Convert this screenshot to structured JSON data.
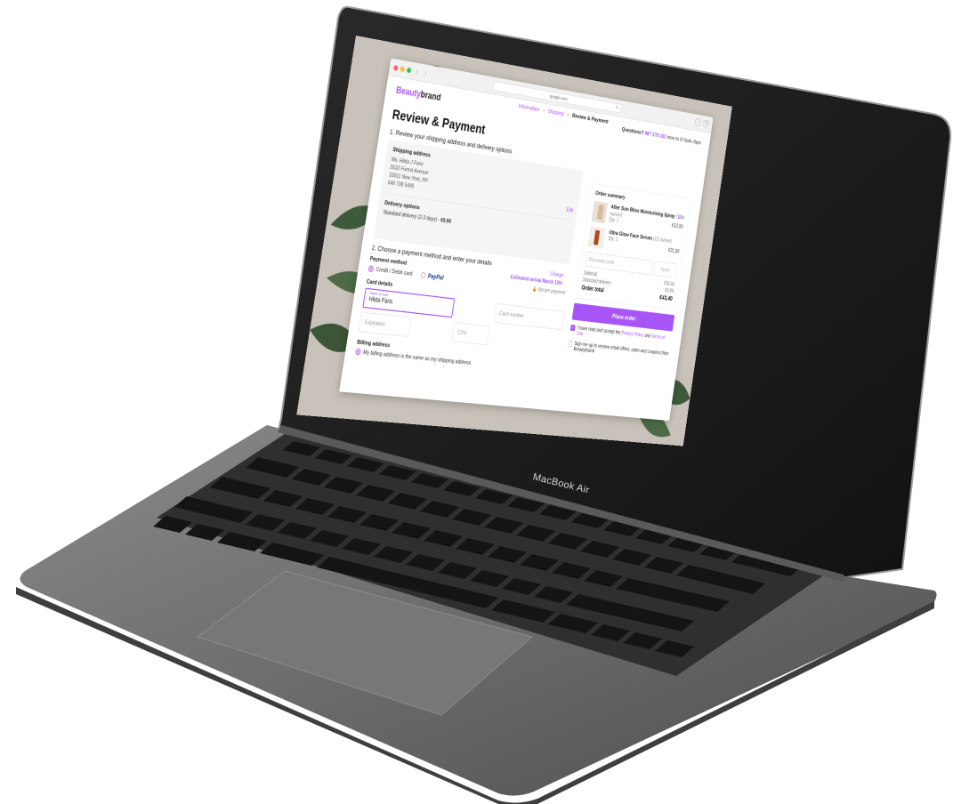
{
  "device": {
    "label": "MacBook Air"
  },
  "browser": {
    "url": "google.com",
    "nav_back": "‹",
    "nav_forward": "›",
    "reload": "↻",
    "share_icon": "share-icon",
    "tabs_icon": "tabs-icon"
  },
  "header": {
    "logo_part1": "Beauty",
    "logo_part2": "brand",
    "questions_label": "Questions?",
    "phone": "987 376 163",
    "hours": "mon to fri 9am–6pm"
  },
  "breadcrumb": {
    "items": [
      "Information",
      "Shipping",
      "Review & Payment"
    ],
    "separator": ">"
  },
  "main": {
    "title": "Review & Payment",
    "step1_title": "1. Review your shipping address and delivery options",
    "shipping_label": "Shipping address",
    "address_lines": [
      "Ms. Hilda J Faris",
      "2632  Forest Avenue",
      "10011  New York, NY",
      "646 738 5495"
    ],
    "edit_label": "Edit",
    "delivery_label": "Delivery options",
    "delivery_text": "Standard delivery (2-3 days) - ",
    "delivery_price": "€9,90",
    "change_label": "Change",
    "eta": "Estimated arrival March 12th",
    "step2_title": "2. Choose a payment method and enter your details",
    "payment_method_label": "Payment method",
    "credit_label": "Credit / Debit card",
    "paypal_label": "PayPal",
    "secure_label": "Secure payment",
    "card_details_label": "Card details",
    "name_on_card_label": "Name on card",
    "name_on_card_value": "Hilda Faris",
    "card_number_placeholder": "Card number",
    "expiration_placeholder": "Expiration",
    "cvv_placeholder": "CVV",
    "billing_label": "Billing address",
    "billing_same": "My billing address is the same as my shipping address"
  },
  "summary": {
    "title": "Order summary",
    "items": [
      {
        "name": "After Sun Bliss Moisturizing Spray",
        "size": "(12 ounce)",
        "qty": "Qty: 1",
        "price": "€12,00"
      },
      {
        "name": "Ultra Glow Face Serum",
        "size": "(12 ounce)",
        "qty": "Qty: 1",
        "price": "€21,50"
      }
    ],
    "edit_label": "Edit",
    "discount_placeholder": "Discount code",
    "apply_label": "Apply",
    "subtotal_label": "Subtotal",
    "subtotal_value": "€33,50",
    "shipping_label": "Standard delivery",
    "shipping_value": "€9,90",
    "total_label": "Order total",
    "total_value": "€43,40",
    "place_order": "Place order",
    "terms_prefix": "I have read and accept the ",
    "privacy": "Privacy Policy",
    "terms_and": " and ",
    "terms": "Terms of Use",
    "signup": "Sign me up to receive email offers, sales and coupons from Beautybrand"
  },
  "colors": {
    "accent": "#a855f7",
    "laptop": "#6b6b6b",
    "keys": "#1a1a1a"
  }
}
